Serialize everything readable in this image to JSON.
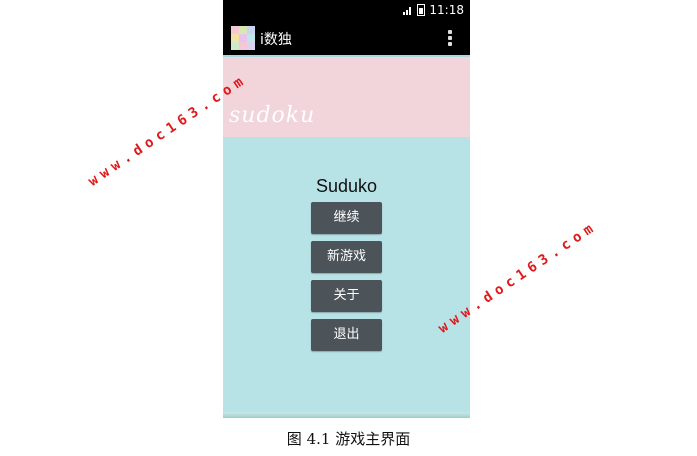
{
  "status_bar": {
    "signal": "3G",
    "time": "11:18"
  },
  "action_bar": {
    "app_title": "i数独",
    "overflow_icon": "overflow-menu-icon",
    "app_icon": "sudoku-grid-icon"
  },
  "banner": {
    "text": "sudoku"
  },
  "main": {
    "title": "Suduko",
    "buttons": [
      {
        "label": "继续"
      },
      {
        "label": "新游戏"
      },
      {
        "label": "关于"
      },
      {
        "label": "退出"
      }
    ]
  },
  "caption": "图 4.1 游戏主界面",
  "watermarks": [
    "www.doc163.com",
    "www.doc163.com"
  ],
  "colors": {
    "banner": "#f2d4db",
    "background": "#b7e2e6",
    "button": "#4c545a",
    "watermark": "#e0191b"
  }
}
